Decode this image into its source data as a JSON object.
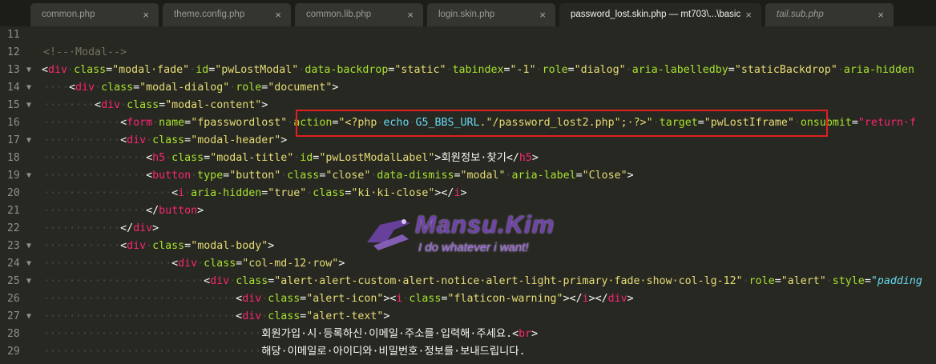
{
  "tabs": [
    {
      "label": "common.php",
      "close": "×"
    },
    {
      "label": "theme.config.php",
      "close": "×"
    },
    {
      "label": "common.lib.php",
      "close": "×"
    },
    {
      "label": "login.skin.php",
      "close": "×"
    },
    {
      "label": "password_lost.skin.php — mt703\\...\\basic",
      "close": "×"
    },
    {
      "label": "tail.sub.php",
      "close": "×"
    }
  ],
  "watermark": {
    "name": "Mansu.Kim",
    "tagline": "I do whatever i want!"
  },
  "lines": [
    {
      "n": "11",
      "fold": ""
    },
    {
      "n": "12",
      "fold": ""
    },
    {
      "n": "13",
      "fold": "▼"
    },
    {
      "n": "14",
      "fold": "▼"
    },
    {
      "n": "15",
      "fold": "▼"
    },
    {
      "n": "16",
      "fold": ""
    },
    {
      "n": "17",
      "fold": "▼"
    },
    {
      "n": "18",
      "fold": ""
    },
    {
      "n": "19",
      "fold": "▼"
    },
    {
      "n": "20",
      "fold": ""
    },
    {
      "n": "21",
      "fold": ""
    },
    {
      "n": "22",
      "fold": ""
    },
    {
      "n": "23",
      "fold": "▼"
    },
    {
      "n": "24",
      "fold": "▼"
    },
    {
      "n": "25",
      "fold": "▼"
    },
    {
      "n": "26",
      "fold": ""
    },
    {
      "n": "27",
      "fold": "▼"
    },
    {
      "n": "28",
      "fold": ""
    },
    {
      "n": "29",
      "fold": ""
    }
  ],
  "code": {
    "l12": {
      "comment": "<!--·Modal-->"
    },
    "l13": {
      "tag": "div",
      "a1": "class",
      "v1": "\"modal·fade\"",
      "a2": "id",
      "v2": "\"pwLostModal\"",
      "a3": "data-backdrop",
      "v3": "\"static\"",
      "a4": "tabindex",
      "v4": "\"-1\"",
      "a5": "role",
      "v5": "\"dialog\"",
      "a6": "aria-labelledby",
      "v6": "\"staticBackdrop\"",
      "a7": "aria-hidden"
    },
    "l14": {
      "tag": "div",
      "a1": "class",
      "v1": "\"modal-dialog\"",
      "a2": "role",
      "v2": "\"document\""
    },
    "l15": {
      "tag": "div",
      "a1": "class",
      "v1": "\"modal-content\""
    },
    "l16": {
      "tag": "form",
      "a1": "name",
      "v1": "\"fpasswordlost\"",
      "a2": "action",
      "v2a": "\"<?php",
      "echo": "echo",
      "const": "G5_BBS_URL",
      "v2b": ".\"/password_lost2.php\";·?>\"",
      "a3": "target",
      "v3": "\"pwLostIframe\"",
      "a4": "onsubmit",
      "v4": "\"return·f"
    },
    "l17": {
      "tag": "div",
      "a1": "class",
      "v1": "\"modal-header\""
    },
    "l18": {
      "tag": "h5",
      "a1": "class",
      "v1": "\"modal-title\"",
      "a2": "id",
      "v2": "\"pwLostModalLabel\"",
      "text": "회원정보·찾기",
      "close": "h5"
    },
    "l19": {
      "tag": "button",
      "a1": "type",
      "v1": "\"button\"",
      "a2": "class",
      "v2": "\"close\"",
      "a3": "data-dismiss",
      "v3": "\"modal\"",
      "a4": "aria-label",
      "v4": "\"Close\""
    },
    "l20": {
      "tag": "i",
      "a1": "aria-hidden",
      "v1": "\"true\"",
      "a2": "class",
      "v2": "\"ki·ki-close\"",
      "close": "i"
    },
    "l21": {
      "close": "button"
    },
    "l22": {
      "close": "div"
    },
    "l23": {
      "tag": "div",
      "a1": "class",
      "v1": "\"modal-body\""
    },
    "l24": {
      "tag": "div",
      "a1": "class",
      "v1": "\"col-md-12·row\""
    },
    "l25": {
      "tag": "div",
      "a1": "class",
      "v1": "\"alert·alert-custom·alert-notice·alert-light-primary·fade·show·col-lg-12\"",
      "a2": "role",
      "v2": "\"alert\"",
      "a3": "style",
      "v3": "\"padding"
    },
    "l26": {
      "tag": "div",
      "a1": "class",
      "v1": "\"alert-icon\"",
      "tag2": "i",
      "a2": "class",
      "v2": "\"flaticon-warning\"",
      "close1": "i",
      "close2": "div"
    },
    "l27": {
      "tag": "div",
      "a1": "class",
      "v1": "\"alert-text\""
    },
    "l28": {
      "text": "회원가입·시·등록하신·이메일·주소를·입력해·주세요.",
      "tag": "br"
    },
    "l29": {
      "text": "해당·이메일로·아이디와·비밀번호·정보를·보내드립니다."
    }
  }
}
